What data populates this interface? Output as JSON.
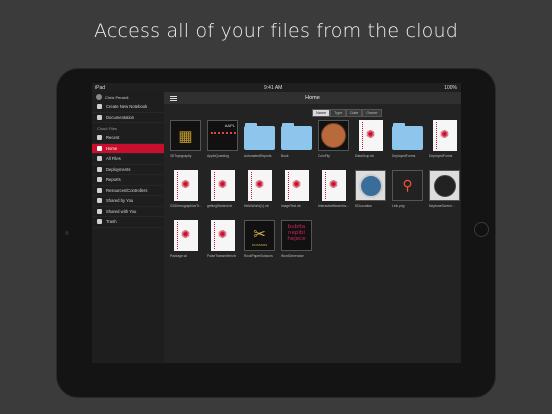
{
  "headline": "Access all of your files from the cloud",
  "status": {
    "left": "iPad",
    "time": "9:41 AM",
    "battery": "100%"
  },
  "user": "Chris Perardi",
  "sidebar": {
    "top_items": [
      {
        "label": "Create New Notebook",
        "icon": "notebook-plus-icon"
      },
      {
        "label": "Documentation",
        "icon": "book-icon"
      }
    ],
    "section": "Cloud Files",
    "items": [
      {
        "label": "Recent",
        "icon": "clock-icon",
        "active": false
      },
      {
        "label": "Home",
        "icon": "home-icon",
        "active": true
      },
      {
        "label": "All Files",
        "icon": "files-icon",
        "active": false
      },
      {
        "label": "Deployments",
        "icon": "cloud-icon",
        "active": false
      },
      {
        "label": "Reports",
        "icon": "report-icon",
        "active": false
      },
      {
        "label": "Resources/Controllers",
        "icon": "gear-icon",
        "active": false
      },
      {
        "label": "Shared by You",
        "icon": "share-icon",
        "active": false
      },
      {
        "label": "Shared with You",
        "icon": "people-icon",
        "active": false
      },
      {
        "label": "Trash",
        "icon": "trash-icon",
        "active": false
      }
    ]
  },
  "main": {
    "title": "Home",
    "sort_options": [
      "Name",
      "Type",
      "Date",
      "Owner"
    ],
    "sort_selected": "Name",
    "files": [
      {
        "name": "3DTopography",
        "kind": "fplot"
      },
      {
        "name": "AppleQuantlog",
        "kind": "aapl"
      },
      {
        "name": "AutomatedReports",
        "kind": "folder"
      },
      {
        "name": "Book",
        "kind": "folder"
      },
      {
        "name": "CoinFlip",
        "kind": "coin"
      },
      {
        "name": "DataGrop.nb",
        "kind": "doc"
      },
      {
        "name": "DeployedForms",
        "kind": "folder"
      },
      {
        "name": "DeployedForms",
        "kind": "doc"
      },
      {
        "name": "GDDemographicsTr...",
        "kind": "doc"
      },
      {
        "name": "gettingStarted.nb",
        "kind": "doc"
      },
      {
        "name": "HelloWorld(1).nb",
        "kind": "doc"
      },
      {
        "name": "imageTest.nb",
        "kind": "doc"
      },
      {
        "name": "InteractiveBeamInv...",
        "kind": "doc"
      },
      {
        "name": "KDLocation",
        "kind": "globe"
      },
      {
        "name": "Link.png",
        "kind": "pin"
      },
      {
        "name": "NeptuneScreen...",
        "kind": "blackcirc"
      },
      {
        "name": "Package.wl",
        "kind": "doc"
      },
      {
        "name": "PulseTransmitter.nb",
        "kind": "doc"
      },
      {
        "name": "RockPaperScissors",
        "kind": "scissors"
      },
      {
        "name": "WordGenerator",
        "kind": "bubita"
      }
    ],
    "thumb_text": {
      "aapl": "AAPL",
      "scissors_caption": "SCISSORS",
      "bubita": "bubita nepibl hejece"
    }
  }
}
